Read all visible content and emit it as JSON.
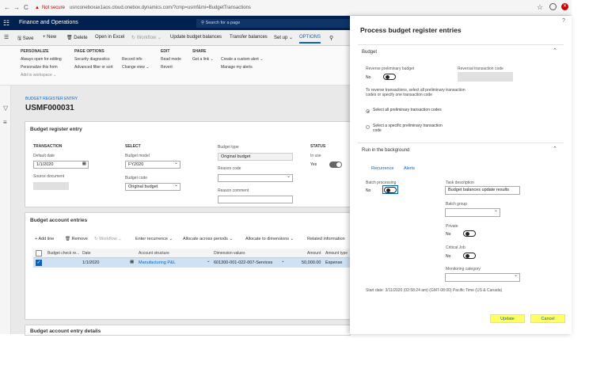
{
  "browser": {
    "back": "←",
    "forward": "→",
    "reload": "C",
    "warning_icon": "▲",
    "security_label": "Not secure",
    "url": "usnconeboxax1aos.cloud.onebox.dynamics.com/?cmp=usmf&mi=BudgetTransactions"
  },
  "header": {
    "app_name": "Finance and Operations",
    "search_placeholder": "Search for a page"
  },
  "actionbar": {
    "save": "Save",
    "new": "New",
    "delete": "Delete",
    "open_excel": "Open in Excel",
    "workflow": "Workflow",
    "update_balances": "Update budget balances",
    "transfer_balances": "Transfer balances",
    "setup": "Set up",
    "options": "OPTIONS"
  },
  "ribbon": {
    "personalize": {
      "title": "PERSONALIZE",
      "items": [
        "Always open for editing",
        "Personalize this form",
        "Add to workspace"
      ]
    },
    "page_options": {
      "title": "PAGE OPTIONS",
      "items": [
        "Security diagnostics",
        "Advanced filter or sort",
        "Record info",
        "Change view"
      ]
    },
    "edit": {
      "title": "EDIT",
      "items": [
        "Read mode",
        "Revert"
      ]
    },
    "share": {
      "title": "SHARE",
      "items": [
        "Get a link",
        "Create a custom alert",
        "Manage my alerts"
      ]
    }
  },
  "page": {
    "breadcrumb": "BUDGET REGISTER ENTRY",
    "record_id": "USMF000031"
  },
  "entry_card": {
    "title": "Budget register entry",
    "transaction_h": "TRANSACTION",
    "default_date_label": "Default date",
    "default_date": "1/1/2020",
    "source_doc_label": "Source document",
    "select_h": "SELECT",
    "budget_model_label": "Budget model",
    "budget_model": "FY2020",
    "budget_code_label": "Budget code",
    "budget_code": "Original budget",
    "budget_type_label": "Budget type",
    "budget_type": "Original budget",
    "reason_code_label": "Reason code",
    "reason_comment_label": "Reason comment",
    "status_h": "STATUS",
    "in_use_label": "In use",
    "in_use": "Yes"
  },
  "accounts_card": {
    "title": "Budget account entries",
    "add_line": "Add line",
    "remove": "Remove",
    "workflow": "Workflow",
    "enter_recurrence": "Enter recurrence",
    "allocate_periods": "Allocate across periods",
    "allocate_dimensions": "Allocate to dimensions",
    "related_info": "Related information",
    "columns": [
      "Budget check re...",
      "Date",
      "Account structure",
      "Dimension values",
      "Amount",
      "Amount type"
    ],
    "row": {
      "date": "1/1/2020",
      "account_structure": "Manufacturing P&L",
      "dimension_values": "601300-001-022-007-Services",
      "amount": "50,000.00",
      "amount_type": "Expense"
    }
  },
  "next_card_title": "Budget account entry details",
  "panel": {
    "title": "Process budget register entries",
    "help": "?",
    "budget_section": "Budget",
    "reverse_prelim_label": "Reverse preliminary budget",
    "reverse_prelim_value": "No",
    "reversal_code_label": "Reversal transaction code",
    "reverse_note": "To reverse transactions, select all preliminary transaction codes or specify one transaction code",
    "radio_all": "Select all preliminary transaction codes",
    "radio_specific": "Select a specific preliminary transaction code",
    "background_section": "Run in the background",
    "tab_recurrence": "Recurrence",
    "tab_alerts": "Alerts",
    "batch_processing_label": "Batch processing",
    "batch_processing_value": "No",
    "task_description_label": "Task description",
    "task_description": "Budget balances update results",
    "batch_group_label": "Batch group",
    "private_label": "Private",
    "private_value": "No",
    "critical_job_label": "Critical Job",
    "critical_job_value": "No",
    "monitoring_label": "Monitoring category",
    "start_date": "Start date: 3/11/2020 (02:58:24 am) (GMT-08:00) Pacific Time (US & Canada)",
    "update_button": "Update",
    "cancel_button": "Cancel"
  },
  "colors": {
    "nav_bar": "#002050",
    "accent": "#0a63b6",
    "highlight_button": "#ffff66"
  }
}
